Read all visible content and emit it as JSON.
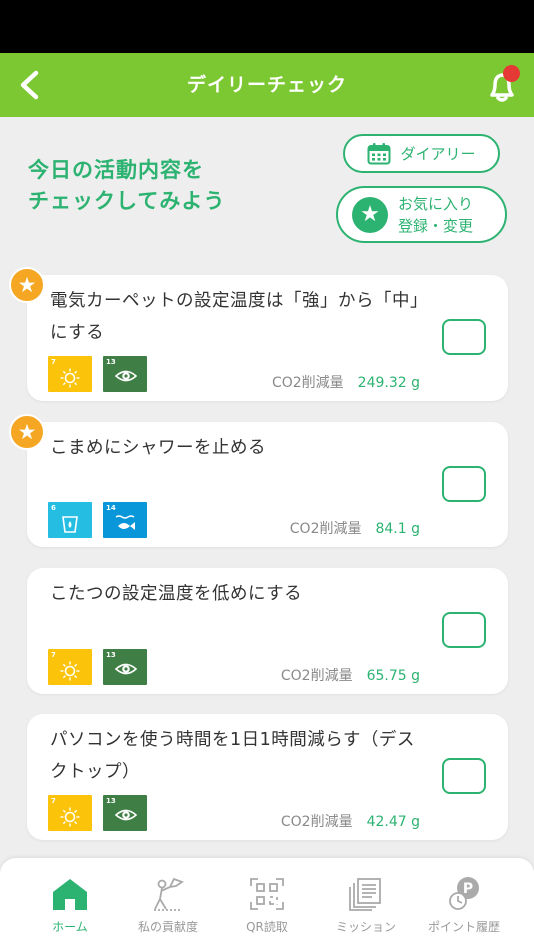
{
  "header": {
    "title": "デイリーチェック"
  },
  "intro": {
    "heading_line1": "今日の活動内容を",
    "heading_line2": "チェックしてみよう",
    "diary_label": "ダイアリー",
    "favorite_line1": "お気に入り",
    "favorite_line2": "登録・変更"
  },
  "colors": {
    "accent": "#2db371",
    "header": "#7cc832",
    "star": "#f5a623",
    "badge": "#e53935"
  },
  "activities": [
    {
      "title": "電気カーペットの設定温度は「強」から「中」にする",
      "favorite": true,
      "sdgs": [
        "7",
        "13"
      ],
      "co2_label": "CO2削減量",
      "co2_value": "249.32 g",
      "checked": false
    },
    {
      "title": "こまめにシャワーを止める",
      "favorite": true,
      "sdgs": [
        "6",
        "14"
      ],
      "co2_label": "CO2削減量",
      "co2_value": "84.1 g",
      "checked": false
    },
    {
      "title": "こたつの設定温度を低めにする",
      "favorite": false,
      "sdgs": [
        "7",
        "13"
      ],
      "co2_label": "CO2削減量",
      "co2_value": "65.75 g",
      "checked": false
    },
    {
      "title": "パソコンを使う時間を1日1時間減らす（デスクトップ）",
      "favorite": false,
      "sdgs": [
        "7",
        "13"
      ],
      "co2_label": "CO2削減量",
      "co2_value": "42.47 g",
      "checked": false
    }
  ],
  "nav": [
    {
      "label": "ホーム",
      "icon": "home-icon",
      "active": true
    },
    {
      "label": "私の貢献度",
      "icon": "contribution-icon",
      "active": false
    },
    {
      "label": "QR読取",
      "icon": "qr-code-icon",
      "active": false
    },
    {
      "label": "ミッション",
      "icon": "mission-icon",
      "active": false
    },
    {
      "label": "ポイント履歴",
      "icon": "point-history-icon",
      "active": false
    }
  ]
}
